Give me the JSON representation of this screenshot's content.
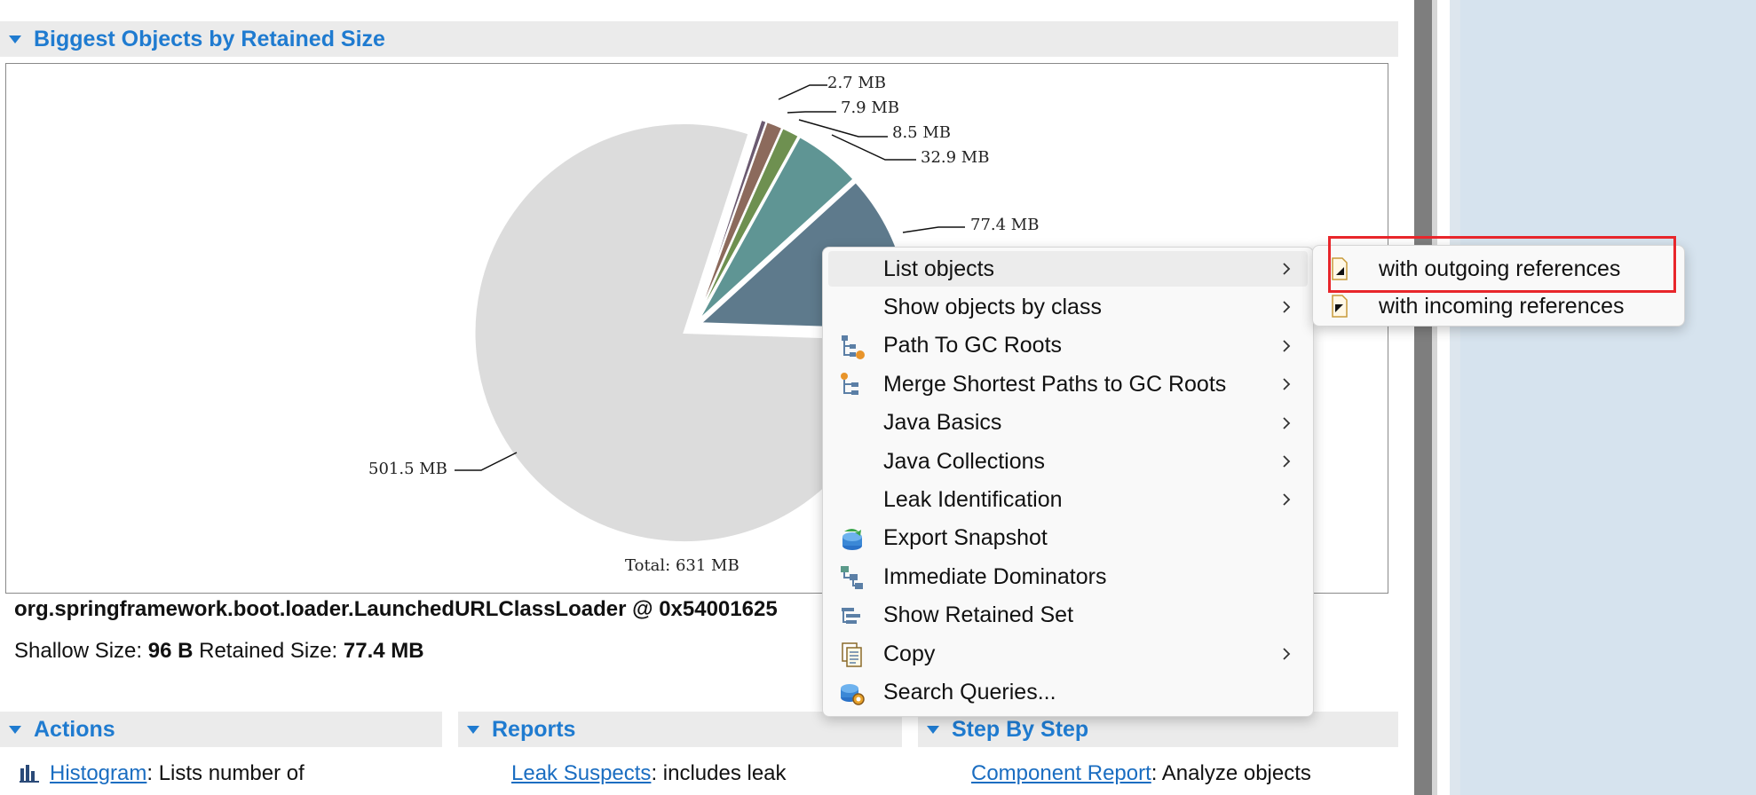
{
  "sections": {
    "biggest": {
      "title": "Biggest Objects by Retained Size"
    },
    "actions": {
      "title": "Actions"
    },
    "reports": {
      "title": "Reports"
    },
    "step_by_step": {
      "title": "Step By Step"
    }
  },
  "chart_data": {
    "type": "pie",
    "unit": "MB",
    "slices": [
      {
        "label": "501.5 MB",
        "value": 501.5,
        "color": "#dcdcdc"
      },
      {
        "label": "77.4 MB",
        "value": 77.4,
        "color": "#5e7a8c"
      },
      {
        "label": "32.9 MB",
        "value": 32.9,
        "color": "#5f9594"
      },
      {
        "label": "8.5 MB",
        "value": 8.5,
        "color": "#6e9050"
      },
      {
        "label": "7.9 MB",
        "value": 7.9,
        "color": "#8c6a5c"
      },
      {
        "label": "2.7 MB",
        "value": 2.7,
        "color": "#6b5a70"
      }
    ],
    "total_label": "Total: 631 MB"
  },
  "object": {
    "name": "org.springframework.boot.loader.LaunchedURLClassLoader @ 0x54001625",
    "shallow_label": "Shallow Size:",
    "shallow_value": "96 B",
    "retained_label": "Retained Size:",
    "retained_value": "77.4 MB"
  },
  "footer": {
    "histogram_link": "Histogram",
    "histogram_text": ": Lists number of",
    "leak_link": "Leak Suspects",
    "leak_text": ": includes leak",
    "component_link": "Component Report",
    "component_text": ": Analyze objects"
  },
  "context_menu": {
    "items": [
      {
        "label": "List objects",
        "icon": "",
        "submenu": true,
        "hover": true
      },
      {
        "label": "Show objects by class",
        "icon": "",
        "submenu": true
      },
      {
        "label": "Path To GC Roots",
        "icon": "path-to-gc-roots-icon",
        "submenu": true
      },
      {
        "label": "Merge Shortest Paths to GC Roots",
        "icon": "merge-paths-icon",
        "submenu": true
      },
      {
        "label": "Java Basics",
        "icon": "",
        "submenu": true
      },
      {
        "label": "Java Collections",
        "icon": "",
        "submenu": true
      },
      {
        "label": "Leak Identification",
        "icon": "",
        "submenu": true
      },
      {
        "label": "Export Snapshot",
        "icon": "export-snapshot-icon",
        "submenu": false
      },
      {
        "label": "Immediate Dominators",
        "icon": "immediate-dominators-icon",
        "submenu": false
      },
      {
        "label": "Show Retained Set",
        "icon": "retained-set-icon",
        "submenu": false
      },
      {
        "label": "Copy",
        "icon": "copy-icon",
        "submenu": true
      },
      {
        "label": "Search Queries...",
        "icon": "search-queries-icon",
        "submenu": false
      }
    ]
  },
  "sub_menu": {
    "items": [
      {
        "label": "with outgoing references",
        "icon": "outgoing-references-icon"
      },
      {
        "label": "with incoming references",
        "icon": "incoming-references-icon"
      }
    ]
  },
  "colors": {
    "accent": "#1f7bd0",
    "highlight": "#e8262b",
    "link": "#1a6dc1"
  }
}
